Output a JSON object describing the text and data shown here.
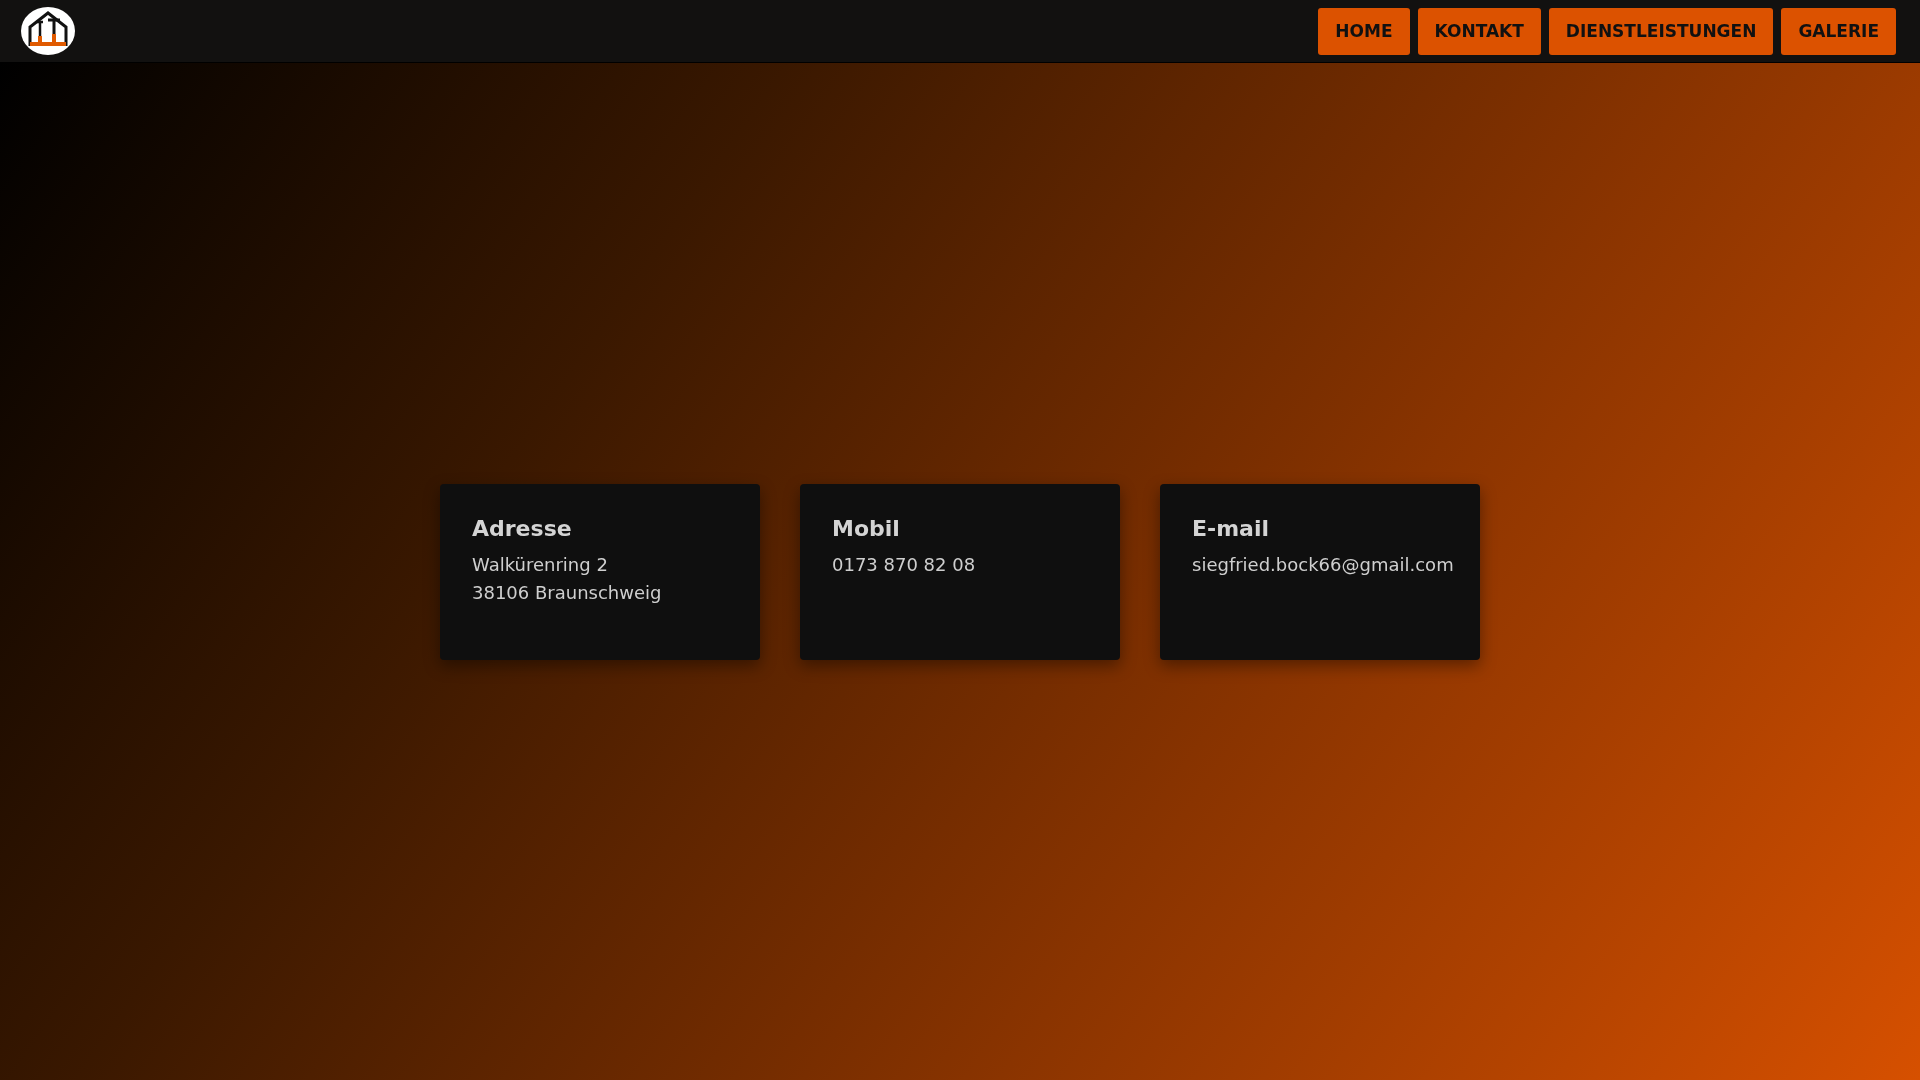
{
  "header": {
    "nav": [
      {
        "label": "HOME"
      },
      {
        "label": "KONTAKT"
      },
      {
        "label": "DIENSTLEISTUNGEN"
      },
      {
        "label": "GALERIE"
      }
    ]
  },
  "contact_cards": [
    {
      "title": "Adresse",
      "lines": [
        "Walkürenring 2",
        "38106 Braunschweig"
      ]
    },
    {
      "title": "Mobil",
      "lines": [
        "0173 870 82 08"
      ]
    },
    {
      "title": "E-mail",
      "lines": [
        "siegfried.bock66@gmail.com"
      ]
    }
  ]
}
